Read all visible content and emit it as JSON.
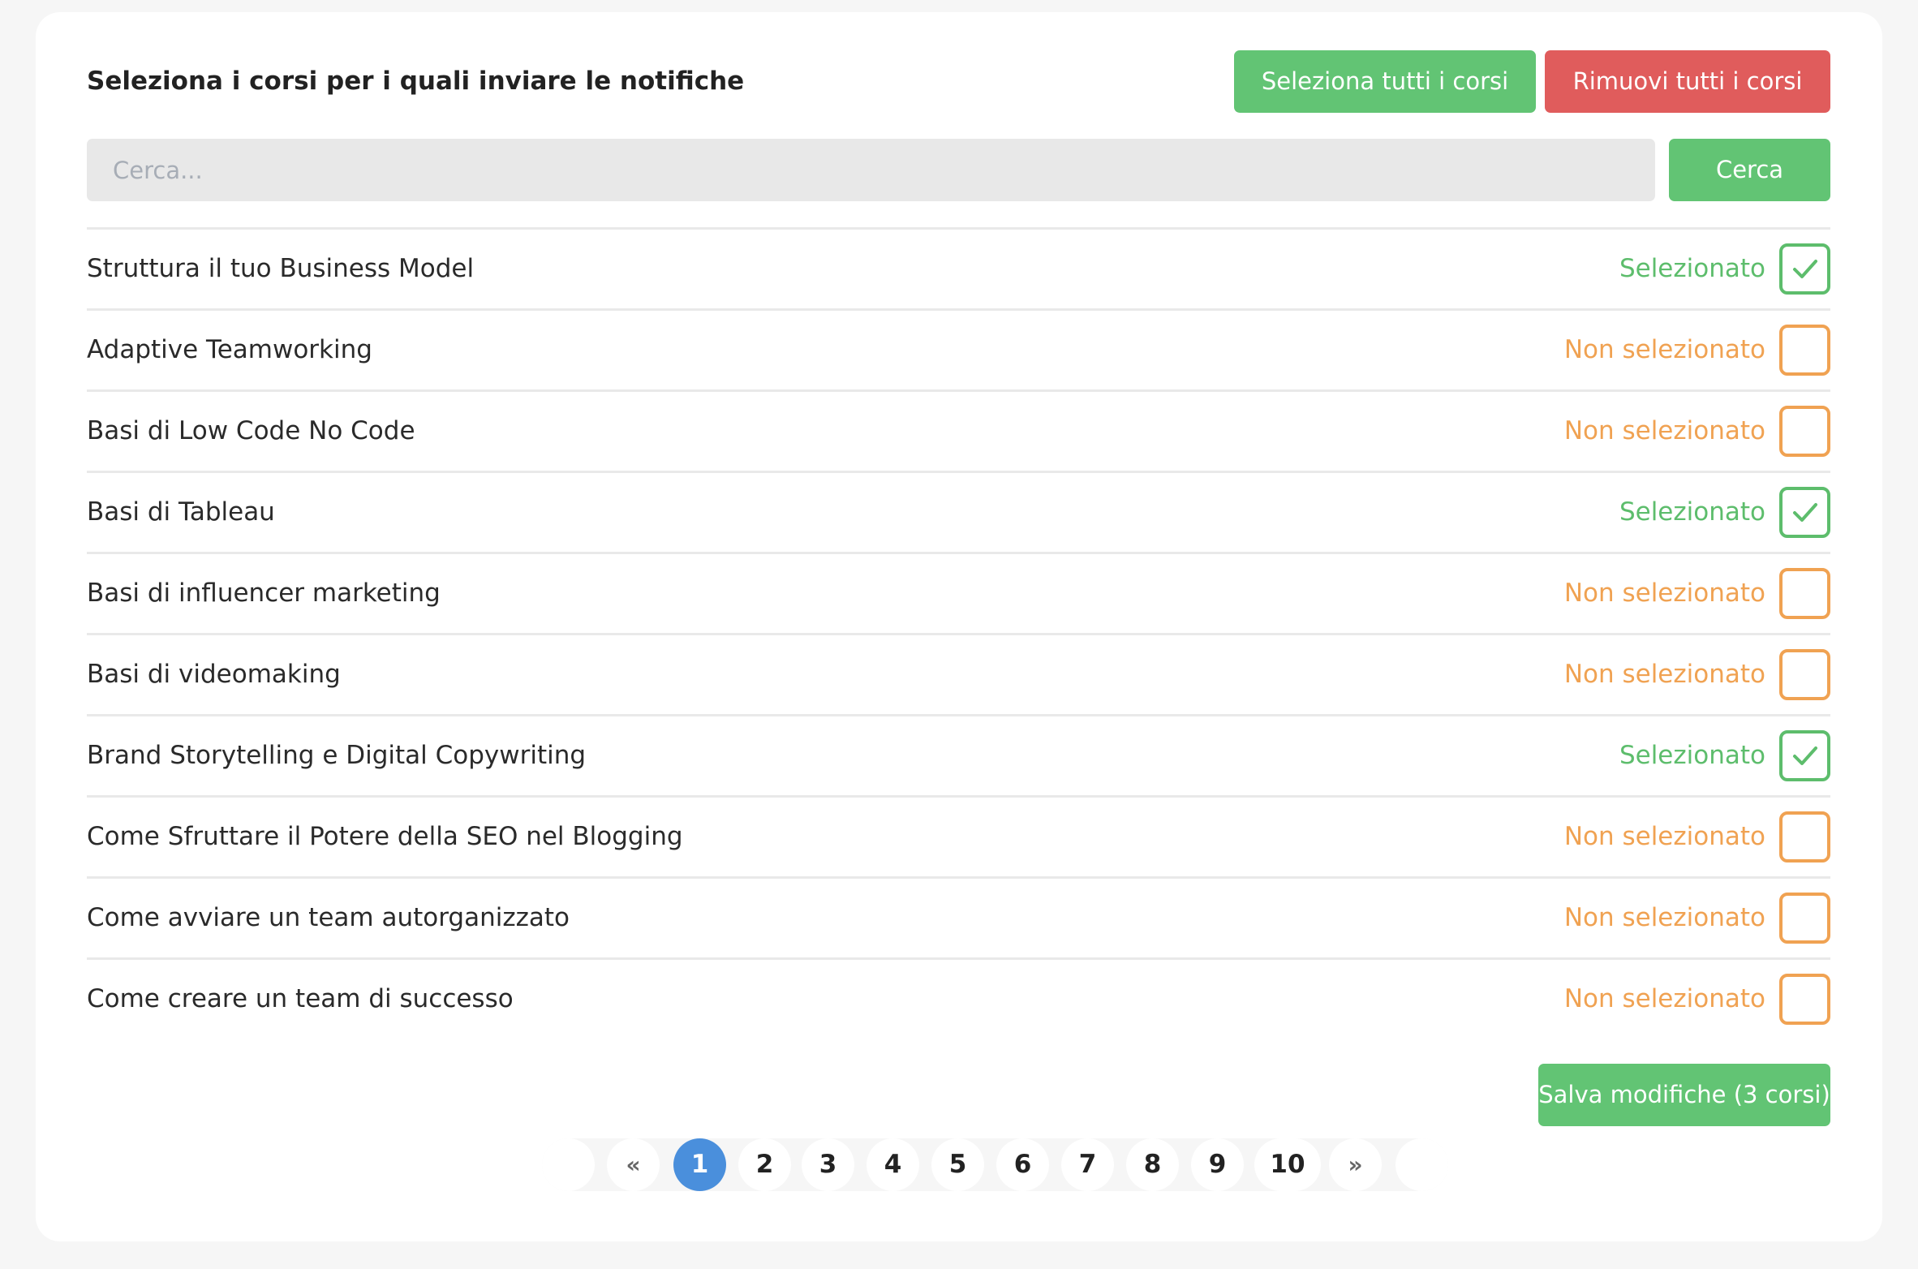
{
  "header": {
    "title": "Seleziona i corsi per i quali inviare le notifiche",
    "select_all_label": "Seleziona tutti i corsi",
    "remove_all_label": "Rimuovi tutti i corsi"
  },
  "search": {
    "placeholder": "Cerca...",
    "value": "",
    "button_label": "Cerca"
  },
  "courses": [
    {
      "name": "Struttura il tuo Business Model",
      "selected": true,
      "status": "Selezionato"
    },
    {
      "name": "Adaptive Teamworking",
      "selected": false,
      "status": "Non selezionato"
    },
    {
      "name": "Basi di Low Code No Code",
      "selected": false,
      "status": "Non selezionato"
    },
    {
      "name": "Basi di Tableau",
      "selected": true,
      "status": "Selezionato"
    },
    {
      "name": "Basi di influencer marketing",
      "selected": false,
      "status": "Non selezionato"
    },
    {
      "name": "Basi di videomaking",
      "selected": false,
      "status": "Non selezionato"
    },
    {
      "name": "Brand Storytelling e Digital Copywriting",
      "selected": true,
      "status": "Selezionato"
    },
    {
      "name": "Come Sfruttare il Potere della SEO nel Blogging",
      "selected": false,
      "status": "Non selezionato"
    },
    {
      "name": "Come avviare un team autorganizzato",
      "selected": false,
      "status": "Non selezionato"
    },
    {
      "name": "Come creare un team di successo",
      "selected": false,
      "status": "Non selezionato"
    }
  ],
  "save": {
    "label": "Salva modifiche (3 corsi)"
  },
  "pagination": {
    "prev_label": "«",
    "next_label": "»",
    "pages": [
      "1",
      "2",
      "3",
      "4",
      "5",
      "6",
      "7",
      "8",
      "9",
      "10"
    ],
    "current": "1"
  },
  "colors": {
    "green": "#62c474",
    "red": "#e05c5c",
    "orange": "#f0a252",
    "active_page": "#4a8fdc"
  },
  "icons": {
    "checkmark": "check-icon"
  }
}
